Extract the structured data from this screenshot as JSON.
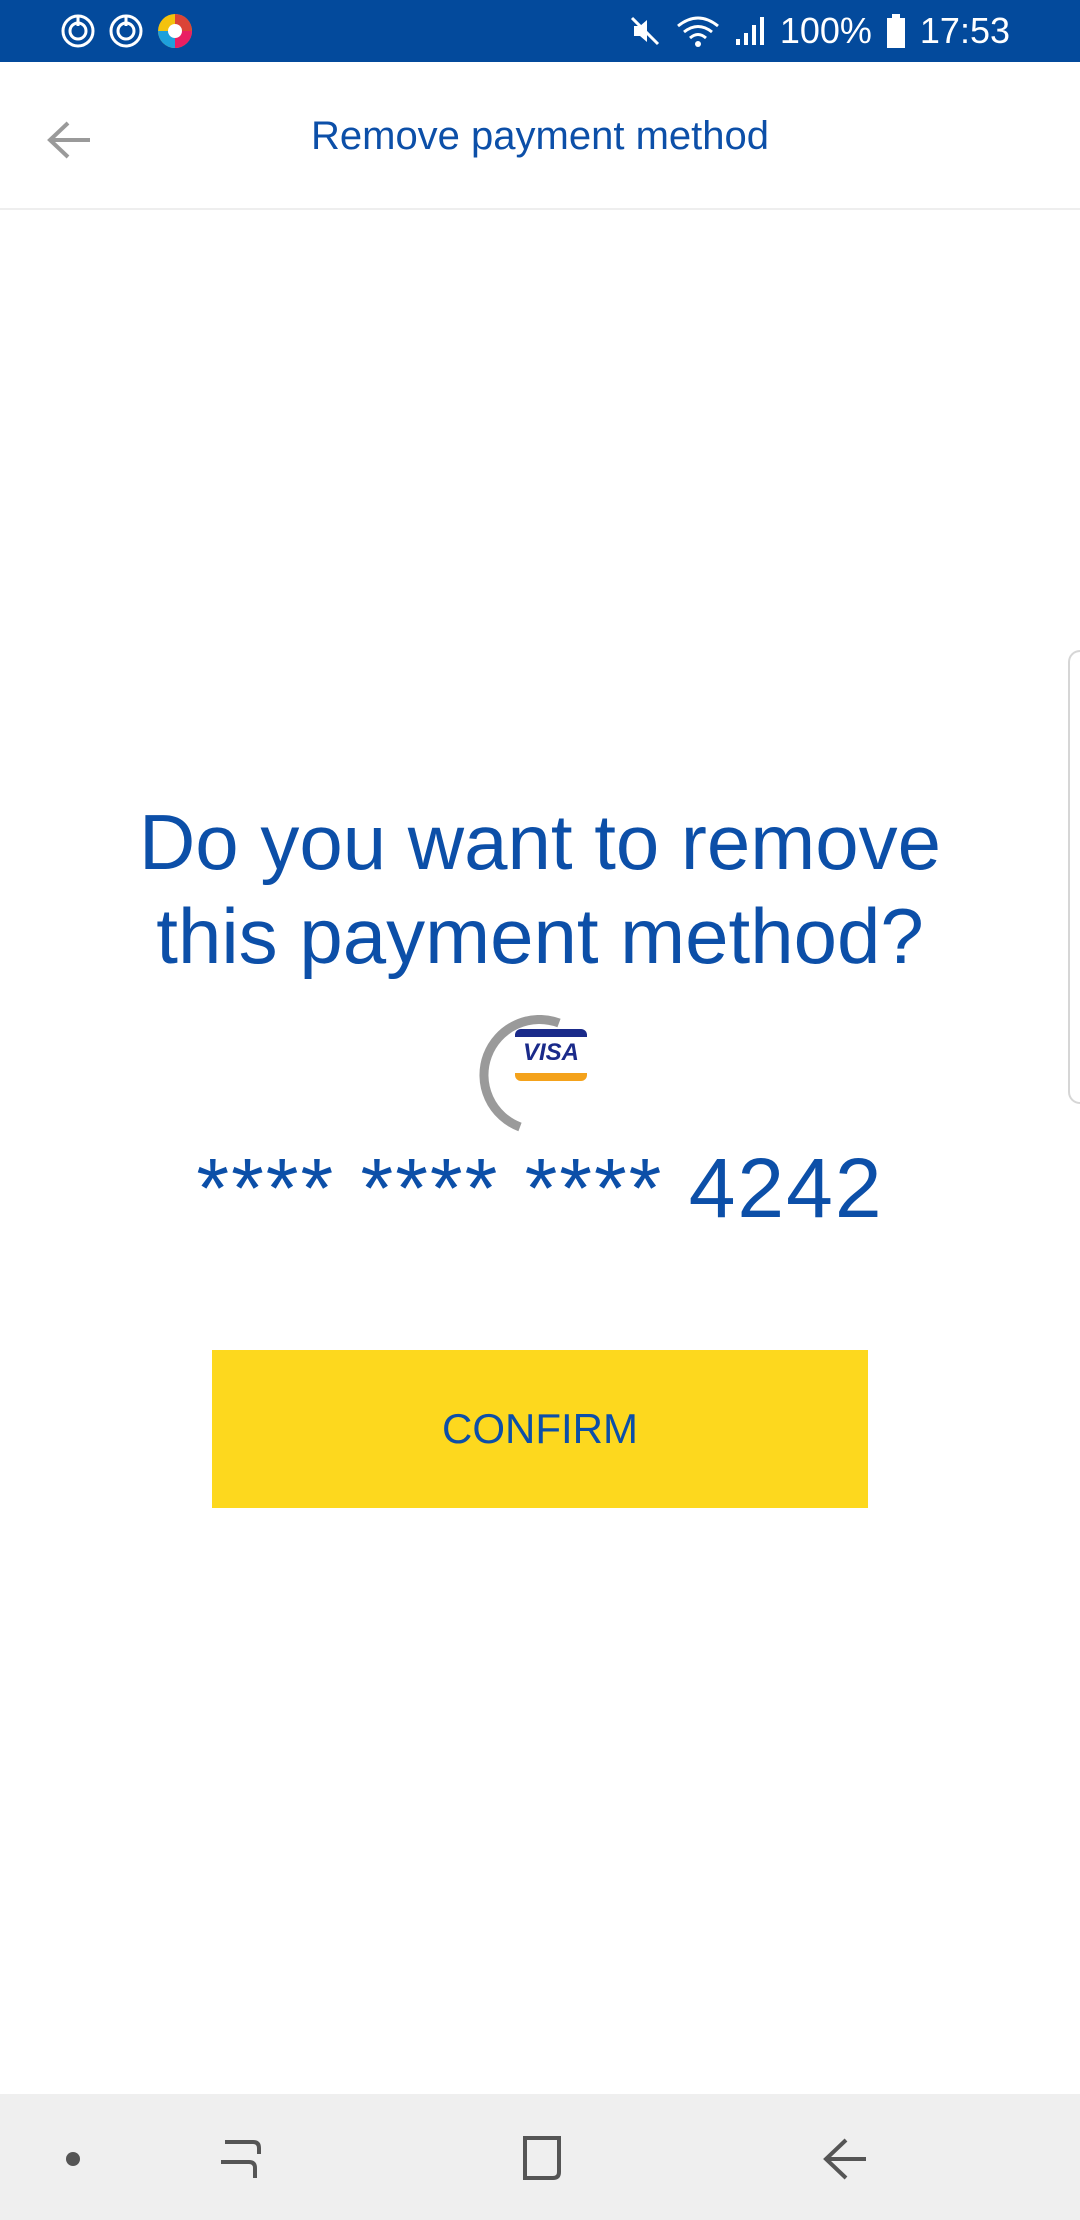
{
  "status_bar": {
    "battery_text": "100%",
    "time": "17:53",
    "icons": [
      "sync-icon",
      "sync-icon",
      "browser-app-icon",
      "mute-icon",
      "wifi-icon",
      "signal-icon",
      "battery-icon"
    ]
  },
  "app_bar": {
    "title": "Remove payment method",
    "back_icon": "arrow-left-icon"
  },
  "main": {
    "question_line1": "Do you want to remove",
    "question_line2": "this payment method?",
    "card_brand": "VISA",
    "card_number": "**** **** **** 4242",
    "confirm_label": "CONFIRM"
  },
  "nav_bar": {
    "icons": [
      "dot-icon",
      "recent-apps-icon",
      "home-icon",
      "back-icon"
    ]
  },
  "colors": {
    "primary_blue": "#0c4fa8",
    "status_bar_blue": "#034a9c",
    "confirm_yellow": "#fdd81e",
    "nav_bar_gray": "#efefef"
  }
}
